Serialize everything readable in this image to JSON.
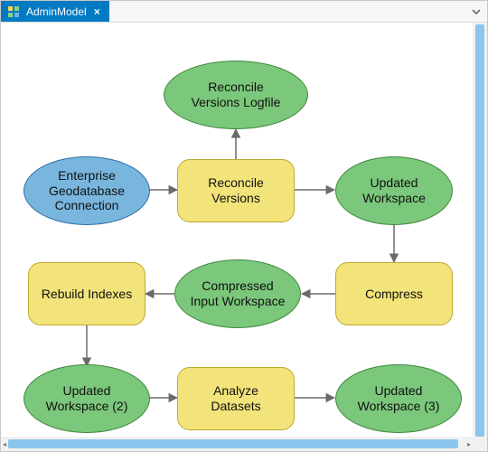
{
  "tab": {
    "title": "AdminModel",
    "icon": "model-icon",
    "close": "×"
  },
  "colors": {
    "input_blue": "#79b6de",
    "data_green": "#7bc77b",
    "tool_yellow": "#f2e37a",
    "tab_blue": "#007ac2",
    "scroll_thumb": "#8ac6ed"
  },
  "nodes": {
    "enterprise_gdb_conn": {
      "label": "Enterprise\nGeodatabase\nConnection"
    },
    "reconcile_versions": {
      "label": "Reconcile\nVersions"
    },
    "reconcile_logfile": {
      "label": "Reconcile\nVersions Logfile"
    },
    "updated_workspace": {
      "label": "Updated\nWorkspace"
    },
    "compress": {
      "label": "Compress"
    },
    "compressed_input_ws": {
      "label": "Compressed\nInput Workspace"
    },
    "rebuild_indexes": {
      "label": "Rebuild Indexes"
    },
    "updated_workspace_2": {
      "label": "Updated\nWorkspace (2)"
    },
    "analyze_datasets": {
      "label": "Analyze\nDatasets"
    },
    "updated_workspace_3": {
      "label": "Updated\nWorkspace (3)"
    }
  },
  "chart_data": {
    "type": "table",
    "title": "AdminModel",
    "nodes": [
      {
        "id": "enterprise_gdb_conn",
        "label": "Enterprise Geodatabase Connection",
        "shape": "ellipse",
        "role": "input",
        "color": "#79b6de"
      },
      {
        "id": "reconcile_versions",
        "label": "Reconcile Versions",
        "shape": "rounded-rect",
        "role": "tool",
        "color": "#f2e37a"
      },
      {
        "id": "reconcile_logfile",
        "label": "Reconcile Versions Logfile",
        "shape": "ellipse",
        "role": "data",
        "color": "#7bc77b"
      },
      {
        "id": "updated_workspace",
        "label": "Updated Workspace",
        "shape": "ellipse",
        "role": "data",
        "color": "#7bc77b"
      },
      {
        "id": "compress",
        "label": "Compress",
        "shape": "rounded-rect",
        "role": "tool",
        "color": "#f2e37a"
      },
      {
        "id": "compressed_input_ws",
        "label": "Compressed Input Workspace",
        "shape": "ellipse",
        "role": "data",
        "color": "#7bc77b"
      },
      {
        "id": "rebuild_indexes",
        "label": "Rebuild Indexes",
        "shape": "rounded-rect",
        "role": "tool",
        "color": "#f2e37a"
      },
      {
        "id": "updated_workspace_2",
        "label": "Updated Workspace (2)",
        "shape": "ellipse",
        "role": "data",
        "color": "#7bc77b"
      },
      {
        "id": "analyze_datasets",
        "label": "Analyze Datasets",
        "shape": "rounded-rect",
        "role": "tool",
        "color": "#f2e37a"
      },
      {
        "id": "updated_workspace_3",
        "label": "Updated Workspace (3)",
        "shape": "ellipse",
        "role": "data",
        "color": "#7bc77b"
      }
    ],
    "edges": [
      {
        "from": "enterprise_gdb_conn",
        "to": "reconcile_versions"
      },
      {
        "from": "reconcile_versions",
        "to": "reconcile_logfile"
      },
      {
        "from": "reconcile_versions",
        "to": "updated_workspace"
      },
      {
        "from": "updated_workspace",
        "to": "compress"
      },
      {
        "from": "compress",
        "to": "compressed_input_ws"
      },
      {
        "from": "compressed_input_ws",
        "to": "rebuild_indexes"
      },
      {
        "from": "rebuild_indexes",
        "to": "updated_workspace_2"
      },
      {
        "from": "updated_workspace_2",
        "to": "analyze_datasets"
      },
      {
        "from": "analyze_datasets",
        "to": "updated_workspace_3"
      }
    ]
  }
}
